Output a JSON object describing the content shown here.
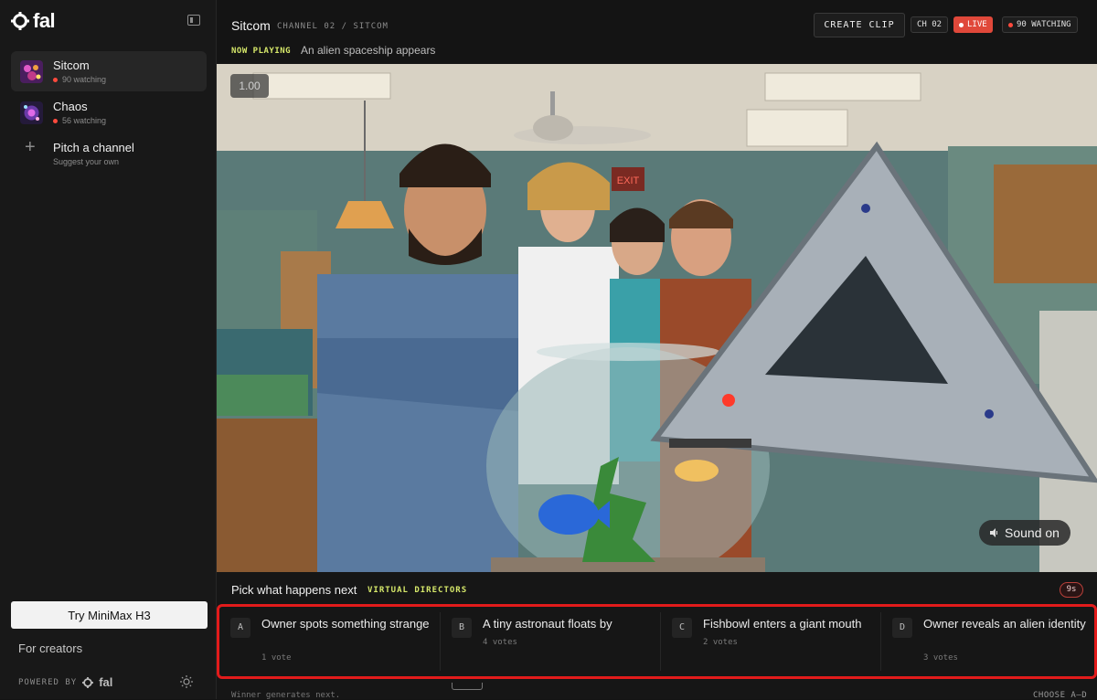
{
  "brand": {
    "name": "fal"
  },
  "sidebar": {
    "channels": [
      {
        "name": "Sitcom",
        "watching": "90 watching"
      },
      {
        "name": "Chaos",
        "watching": "56 watching"
      }
    ],
    "pitch": {
      "title": "Pitch a channel",
      "subtitle": "Suggest your own"
    },
    "try_button": "Try MiniMax H3",
    "creators_link": "For creators",
    "powered_by": "POWERED BY",
    "powered_brand": "fal"
  },
  "header": {
    "title": "Sitcom",
    "channel_path": "CHANNEL 02 / SITCOM",
    "now_playing_label": "NOW PLAYING",
    "now_playing_text": "An alien spaceship appears",
    "create_clip": "CREATE CLIP",
    "channel_badge": "CH 02",
    "live_badge": "LIVE",
    "watching_badge": "90 WATCHING"
  },
  "video": {
    "speed": "1.00",
    "sound_button": "Sound on",
    "exit_sign": "EXIT"
  },
  "voting": {
    "prompt": "Pick what happens next",
    "tag": "VIRTUAL DIRECTORS",
    "timer": "9s",
    "options": [
      {
        "letter": "A",
        "title": "Owner spots something strange",
        "votes": "1 vote"
      },
      {
        "letter": "B",
        "title": "A tiny astronaut floats by",
        "votes": "4 votes"
      },
      {
        "letter": "C",
        "title": "Fishbowl enters a giant mouth",
        "votes": "2 votes"
      },
      {
        "letter": "D",
        "title": "Owner reveals an alien identity",
        "votes": "3 votes"
      }
    ],
    "footer_left": "Winner generates next.",
    "footer_right": "CHOOSE A–D"
  },
  "colors": {
    "accent_yellow": "#d6e86a",
    "live_red": "#e0483a",
    "highlight_red": "#e21b1b"
  }
}
